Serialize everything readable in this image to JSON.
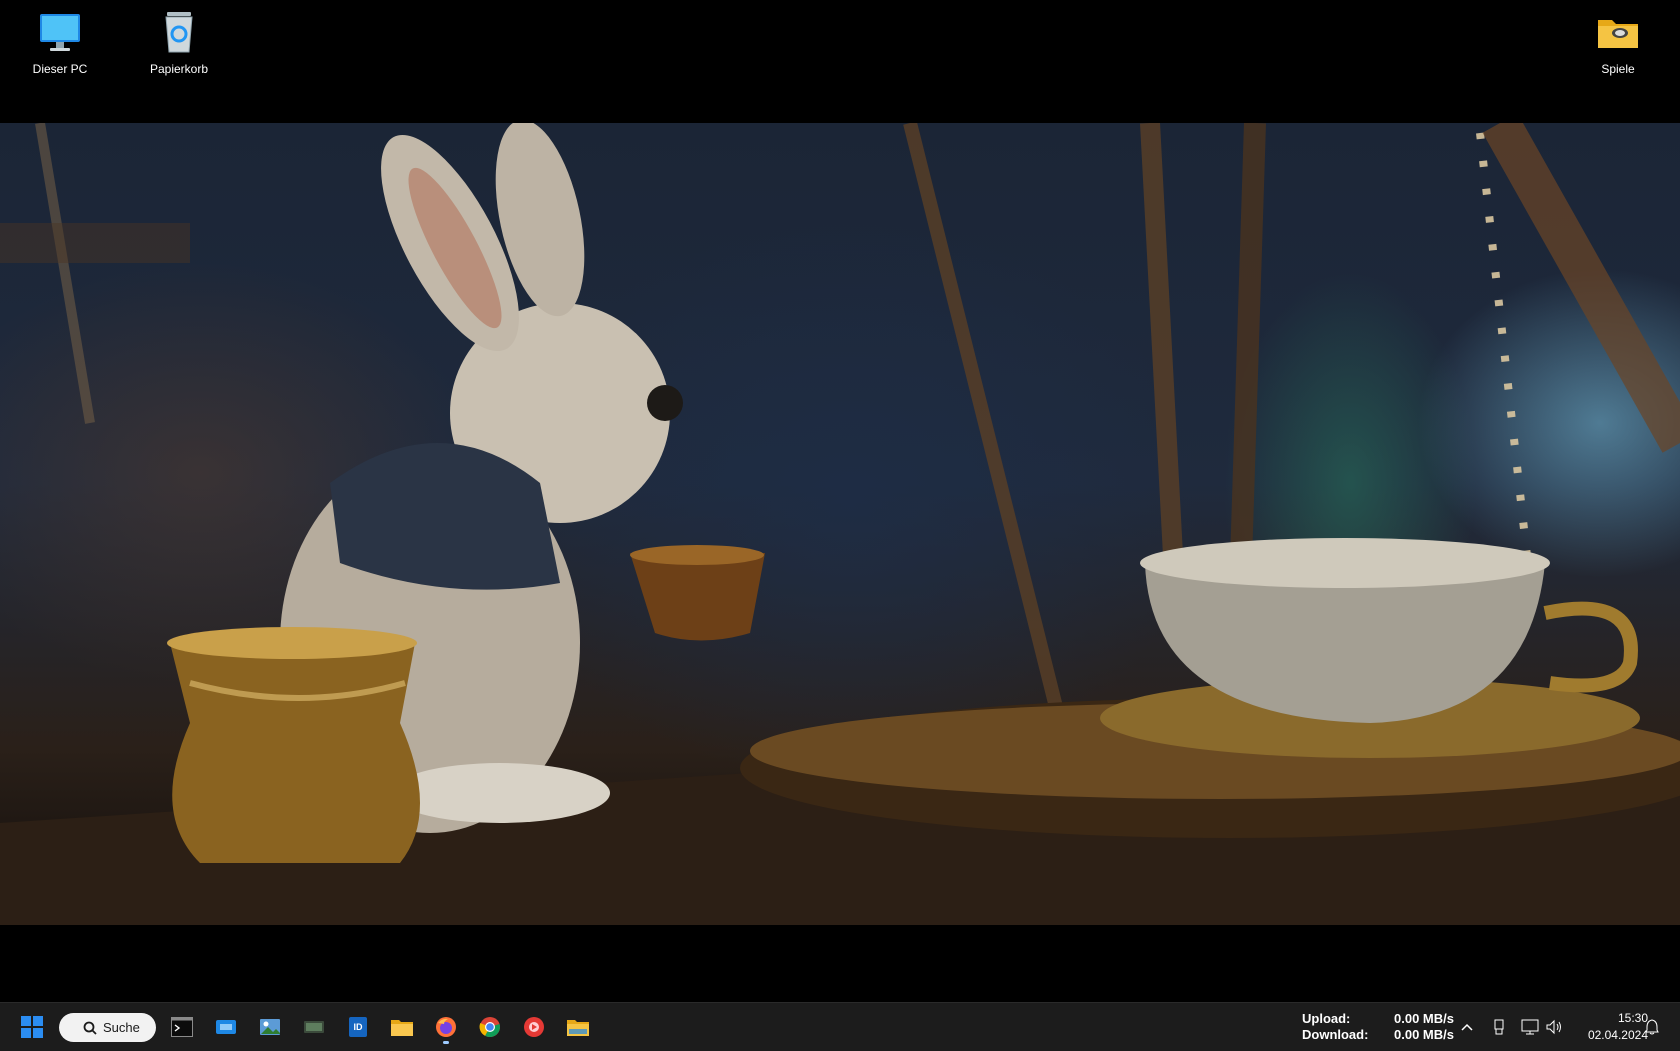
{
  "desktop": {
    "icons": [
      {
        "label": "Dieser PC",
        "icon": "monitor-icon"
      },
      {
        "label": "Papierkorb",
        "icon": "recycle-bin-icon"
      },
      {
        "label": "Spiele",
        "icon": "folder-icon"
      }
    ]
  },
  "taskbar": {
    "search_label": "Suche",
    "apps": [
      {
        "icon": "terminal-icon"
      },
      {
        "icon": "remote-app-icon"
      },
      {
        "icon": "image-viewer-icon"
      },
      {
        "icon": "media-app-icon"
      },
      {
        "icon": "id-card-icon"
      },
      {
        "icon": "file-explorer-icon"
      },
      {
        "icon": "firefox-icon",
        "active": true
      },
      {
        "icon": "chrome-icon"
      },
      {
        "icon": "red-app-icon"
      },
      {
        "icon": "folder-icon"
      }
    ],
    "network": {
      "upload_label": "Upload:",
      "upload_value": "0.00 MB/s",
      "download_label": "Download:",
      "download_value": "0.00 MB/s"
    },
    "tray": [
      "chevron-up-icon",
      "usb-icon",
      "network-icon",
      "volume-icon"
    ],
    "clock": {
      "time": "15:30",
      "date": "02.04.2024"
    },
    "notification_icon": "bell-icon"
  },
  "colors": {
    "taskbar_bg": "#1c1c1c",
    "start_blue": "#2b8df2",
    "folder_yellow": "#f5c443"
  }
}
